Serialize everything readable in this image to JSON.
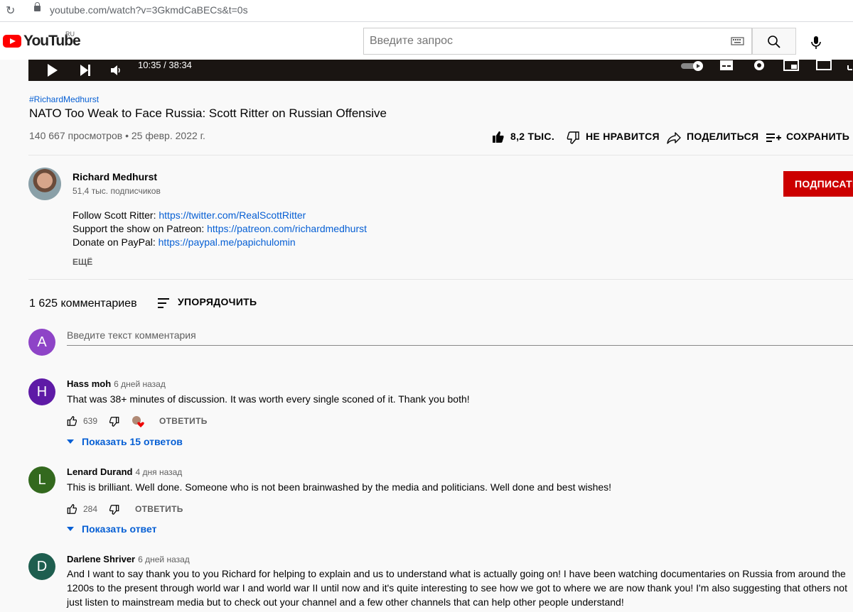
{
  "browser": {
    "url": "youtube.com/watch?v=3GkmdCaBECs&t=0s"
  },
  "masthead": {
    "logo_text": "YouTube",
    "region": "RU",
    "search_placeholder": "Введите запрос"
  },
  "player": {
    "time": "10:35 / 38:34"
  },
  "video": {
    "hashtag": "#RichardMedhurst",
    "title": "NATO Too Weak to Face Russia: Scott Ritter on Russian Offensive",
    "views_date": "140 667 просмотров • 25 февр. 2022 г.",
    "like_count": "8,2 ТЫС.",
    "dislike_label": "НЕ НРАВИТСЯ",
    "share_label": "ПОДЕЛИТЬСЯ",
    "save_label": "СОХРАНИТЬ"
  },
  "channel": {
    "name": "Richard Medhurst",
    "subscribers": "51,4 тыс. подписчиков",
    "subscribe_label": "ПОДПИСАТЬ"
  },
  "description": {
    "lines": [
      {
        "prefix": "Follow Scott Ritter: ",
        "link": "https://twitter.com/RealScottRitter"
      },
      {
        "prefix": "Support the show on Patreon: ",
        "link": "https://patreon.com/richardmedhurst"
      },
      {
        "prefix": "Donate on PayPal: ",
        "link": "https://paypal.me/papichulomin"
      }
    ],
    "more_label": "ЕЩЁ"
  },
  "comments": {
    "count": "1 625 комментариев",
    "sort_label": "УПОРЯДОЧИТЬ",
    "input_placeholder": "Введите текст комментария",
    "user_initial": "A",
    "items": [
      {
        "initial": "H",
        "color": "#5e1aa6",
        "author": "Hass moh",
        "time": "6 дней назад",
        "text": "That was 38+ minutes of discussion. It was worth every single sconed of it. Thank you both!",
        "likes": "639",
        "reply_label": "ОТВЕТИТЬ",
        "show_replies": "Показать 15 ответов"
      },
      {
        "initial": "L",
        "color": "#33691e",
        "author": "Lenard Durand",
        "time": "4 дня назад",
        "text": "This is brilliant.  Well done.  Someone who is not been brainwashed by the media and politicians.  Well done and best wishes!",
        "likes": "284",
        "reply_label": "ОТВЕТИТЬ",
        "show_replies": "Показать ответ"
      },
      {
        "initial": "D",
        "color": "#1e5e4f",
        "author": "Darlene Shriver",
        "time": "6 дней назад",
        "text": "And I want to say thank you to you Richard for helping to explain and us to understand what is actually going on! I have been watching documentaries on Russia from around the 1200s to the present through world war I and world war II until now and it's quite interesting to see how we got to where we are now thank you! I'm also suggesting that others not just listen to mainstream media but to check out your channel and a few other channels that can help other people understand!"
      }
    ]
  }
}
